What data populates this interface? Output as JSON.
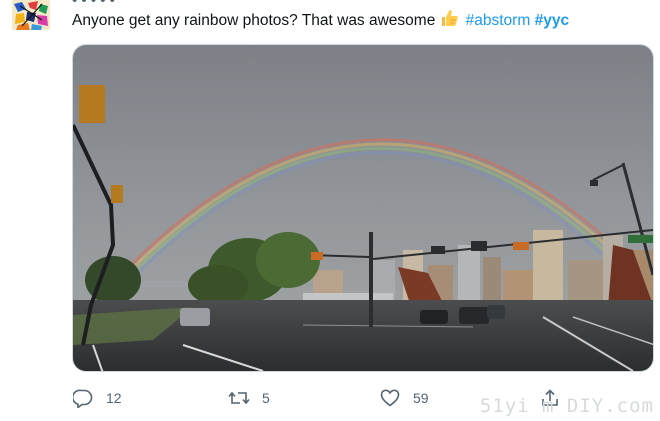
{
  "tweet": {
    "text_prefix": "Anyone get any rainbow photos? That was awesome",
    "emoji_name": "thumbs-up-icon",
    "hashtags": [
      "#abstorm",
      "#yyc"
    ],
    "partial_header": "• • • • •"
  },
  "actions": {
    "reply_count": "12",
    "retweet_count": "5",
    "like_count": "59"
  },
  "watermark": "51yi m DIY.com",
  "colors": {
    "hashtag": "#1d9bf0",
    "action_gray": "#536471"
  }
}
